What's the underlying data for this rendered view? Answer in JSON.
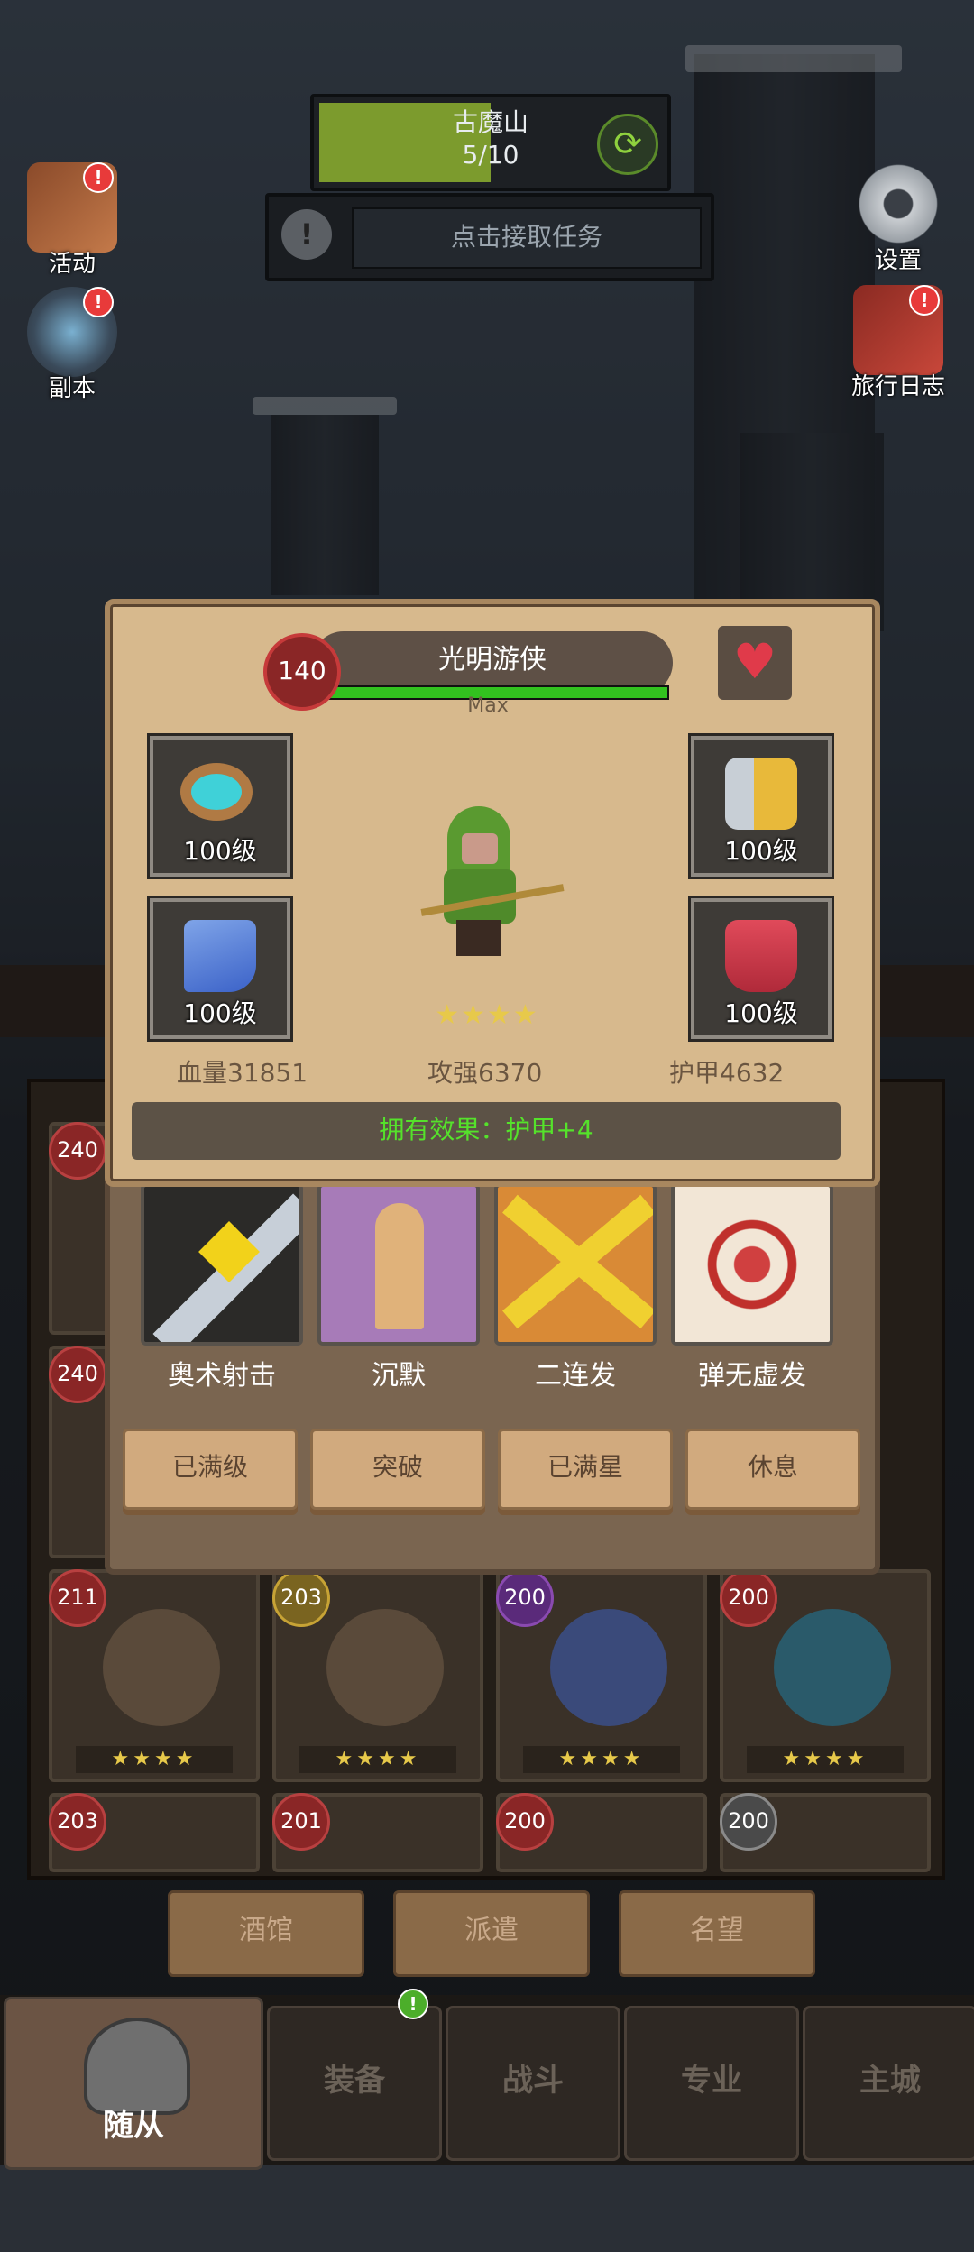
{
  "top": {
    "area_name": "古魔山",
    "progress": "5/10",
    "progress_fraction": 0.5,
    "task_label": "点击接取任务"
  },
  "side": {
    "activity": "活动",
    "dungeon": "副本",
    "settings": "设置",
    "journal": "旅行日志"
  },
  "hero": {
    "level": "140",
    "name": "光明游侠",
    "hp_bar_fraction": 1.0,
    "max_label": "Max",
    "stars": "★★★★",
    "stats": {
      "hp": "血量31851",
      "atk": "攻强6370",
      "armor": "护甲4632"
    },
    "effect": "拥有效果：护甲+4",
    "equipment": [
      {
        "slot": "ring",
        "level": "100级",
        "icon": "ring-icon"
      },
      {
        "slot": "bracer",
        "level": "100级",
        "icon": "bracer-icon"
      },
      {
        "slot": "cloak",
        "level": "100级",
        "icon": "cloak-icon"
      },
      {
        "slot": "boots",
        "level": "100级",
        "icon": "boots-icon"
      }
    ],
    "skills": [
      {
        "name": "奥术射击",
        "icon": "arcane-shot-icon"
      },
      {
        "name": "沉默",
        "icon": "silence-icon"
      },
      {
        "name": "二连发",
        "icon": "double-shot-icon"
      },
      {
        "name": "弹无虚发",
        "icon": "bullseye-icon"
      }
    ],
    "actions": [
      "已满级",
      "突破",
      "已满星",
      "休息"
    ]
  },
  "roster": {
    "cards": [
      {
        "level": "240",
        "stars": ""
      },
      {
        "level": "240",
        "stars": ""
      },
      {
        "level": "211",
        "stars": "★★★★"
      },
      {
        "level": "203",
        "stars": "★★★★"
      },
      {
        "level": "200",
        "stars": "★★★★"
      },
      {
        "level": "200",
        "stars": "★★★★"
      },
      {
        "level": "203",
        "stars": ""
      },
      {
        "level": "201",
        "stars": ""
      },
      {
        "level": "200",
        "stars": ""
      },
      {
        "level": "200",
        "stars": ""
      }
    ]
  },
  "sub_buttons": [
    "酒馆",
    "派遣",
    "名望"
  ],
  "tabs": {
    "followers": "随从",
    "equipment": "装备",
    "battle": "战斗",
    "profession": "专业",
    "city": "主城"
  },
  "colors": {
    "hp_green": "#32c21f",
    "effect_green": "#55e22b",
    "level_red": "#8a2626",
    "star_gold": "#e7c94a"
  }
}
